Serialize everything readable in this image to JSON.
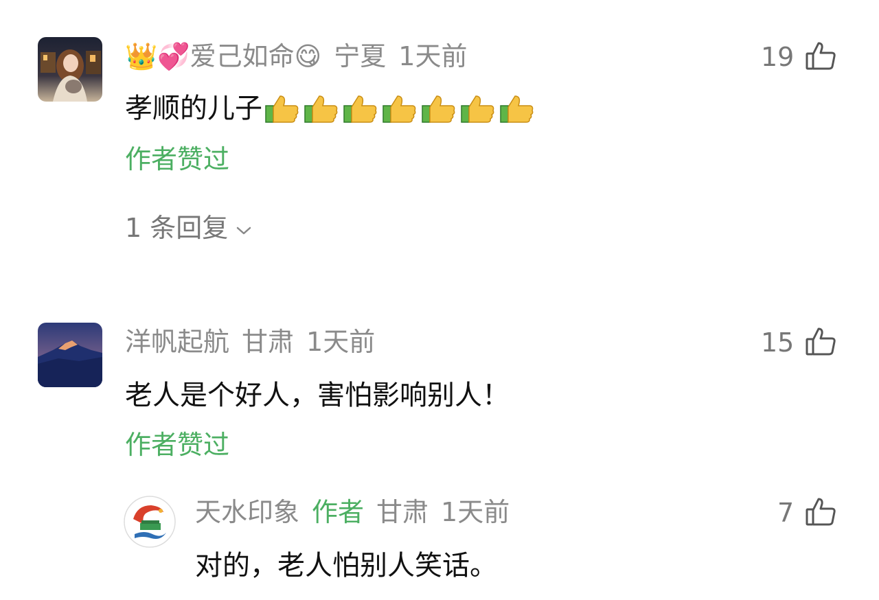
{
  "comments": [
    {
      "username": "👑💞爱己如命😋",
      "location": "宁夏",
      "time": "1天前",
      "likes": "19",
      "text": "孝顺的儿子",
      "emojis": [
        "thumbs-up",
        "thumbs-up",
        "thumbs-up",
        "thumbs-up",
        "thumbs-up",
        "thumbs-up",
        "thumbs-up"
      ],
      "liked_by_author": "作者赞过",
      "replies_label": "1 条回复"
    },
    {
      "username": "洋帆起航",
      "location": "甘肃",
      "time": "1天前",
      "likes": "15",
      "text": "老人是个好人，害怕影响别人！",
      "liked_by_author": "作者赞过",
      "reply": {
        "username": "天水印象",
        "author_tag": "作者",
        "location": "甘肃",
        "time": "1天前",
        "likes": "7",
        "text": "对的，老人怕别人笑话。"
      }
    }
  ],
  "icons": {
    "like": "thumbs-up-outline-icon",
    "expand": "chevron-down-icon"
  },
  "colors": {
    "author_green": "#4CAF62",
    "meta_gray": "#8a8a8a"
  }
}
